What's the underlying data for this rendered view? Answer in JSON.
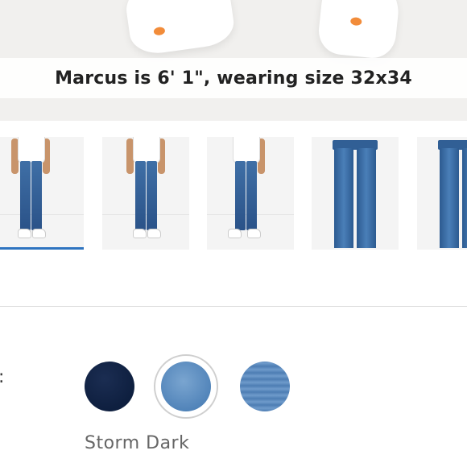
{
  "hero": {
    "caption": "Marcus is 6' 1\", wearing size 32x34"
  },
  "thumbnails": [
    {
      "view": "front-model",
      "selected": true
    },
    {
      "view": "back-model",
      "selected": false
    },
    {
      "view": "side-model",
      "selected": false
    },
    {
      "view": "jeans-flat-front",
      "selected": false
    },
    {
      "view": "jeans-flat-back",
      "selected": false
    }
  ],
  "colors": {
    "label_suffix": ":",
    "selected_name": "Storm Dark",
    "swatches": [
      {
        "name": "dark-rinse",
        "color": "#0e1f3f",
        "selected": false
      },
      {
        "name": "storm-dark",
        "color": "#5b8ec2",
        "selected": true
      },
      {
        "name": "light-wash",
        "color": "#5a88bd",
        "selected": false
      }
    ]
  },
  "theme": {
    "active_indicator": "#2f74c0"
  }
}
